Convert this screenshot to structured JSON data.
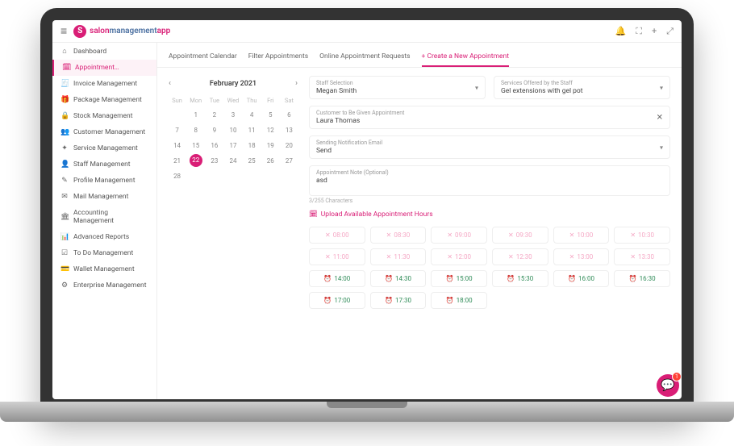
{
  "brand": {
    "logo": "S",
    "text1": "salon",
    "text2": "management",
    "text3": "app"
  },
  "sidebar": [
    {
      "icon": "⌂",
      "label": "Dashboard"
    },
    {
      "icon": "🗓",
      "label": "Appointment…"
    },
    {
      "icon": "🧾",
      "label": "Invoice Management"
    },
    {
      "icon": "🎁",
      "label": "Package Management"
    },
    {
      "icon": "🔒",
      "label": "Stock Management"
    },
    {
      "icon": "👥",
      "label": "Customer Management"
    },
    {
      "icon": "✦",
      "label": "Service Management"
    },
    {
      "icon": "👤",
      "label": "Staff Management"
    },
    {
      "icon": "✎",
      "label": "Profile Management"
    },
    {
      "icon": "✉",
      "label": "Mail Management"
    },
    {
      "icon": "🏛",
      "label": "Accounting Management"
    },
    {
      "icon": "📊",
      "label": "Advanced Reports"
    },
    {
      "icon": "☑",
      "label": "To Do Management"
    },
    {
      "icon": "💳",
      "label": "Wallet Management"
    },
    {
      "icon": "⚙",
      "label": "Enterprise Management"
    }
  ],
  "tabs": [
    "Appointment Calendar",
    "Filter Appointments",
    "Online Appointment Requests",
    "+ Create a New Appointment"
  ],
  "cal": {
    "title": "February 2021",
    "dow": [
      "Sun",
      "Mon",
      "Tue",
      "Wed",
      "Thu",
      "Fri",
      "Sat"
    ],
    "days": [
      {
        "n": "",
        "m": 1
      },
      {
        "n": "1",
        "m": 0
      },
      {
        "n": "2",
        "m": 0
      },
      {
        "n": "3",
        "m": 0
      },
      {
        "n": "4",
        "m": 0
      },
      {
        "n": "5",
        "m": 0
      },
      {
        "n": "6",
        "m": 0
      },
      {
        "n": "7",
        "m": 0
      },
      {
        "n": "8",
        "m": 0
      },
      {
        "n": "9",
        "m": 0
      },
      {
        "n": "10",
        "m": 0
      },
      {
        "n": "11",
        "m": 0
      },
      {
        "n": "12",
        "m": 0
      },
      {
        "n": "13",
        "m": 0
      },
      {
        "n": "14",
        "m": 0
      },
      {
        "n": "15",
        "m": 0
      },
      {
        "n": "16",
        "m": 0
      },
      {
        "n": "17",
        "m": 0
      },
      {
        "n": "18",
        "m": 0
      },
      {
        "n": "19",
        "m": 0
      },
      {
        "n": "20",
        "m": 0
      },
      {
        "n": "21",
        "m": 0
      },
      {
        "n": "22",
        "m": 0,
        "sel": 1
      },
      {
        "n": "23",
        "m": 0
      },
      {
        "n": "24",
        "m": 0
      },
      {
        "n": "25",
        "m": 0
      },
      {
        "n": "26",
        "m": 0
      },
      {
        "n": "27",
        "m": 0
      },
      {
        "n": "28",
        "m": 0
      }
    ]
  },
  "form": {
    "staff": {
      "label": "Staff Selection",
      "value": "Megan Smith"
    },
    "service": {
      "label": "Services Offered by the Staff",
      "value": "Gel extensions with gel pot"
    },
    "customer": {
      "label": "Customer to Be Given Appointment",
      "value": "Laura Thomas"
    },
    "notify": {
      "label": "Sending Notification Email",
      "value": "Send"
    },
    "note": {
      "label": "Appointment Note (Optional)",
      "value": "asd"
    },
    "chars": "3/255 Characters",
    "upload": "Upload Available Appointment Hours"
  },
  "slots": [
    {
      "t": "08:00",
      "a": 0
    },
    {
      "t": "08:30",
      "a": 0
    },
    {
      "t": "09:00",
      "a": 0
    },
    {
      "t": "09:30",
      "a": 0
    },
    {
      "t": "10:00",
      "a": 0
    },
    {
      "t": "10:30",
      "a": 0
    },
    {
      "t": "11:00",
      "a": 0
    },
    {
      "t": "11:30",
      "a": 0
    },
    {
      "t": "12:00",
      "a": 0
    },
    {
      "t": "12:30",
      "a": 0
    },
    {
      "t": "13:00",
      "a": 0
    },
    {
      "t": "13:30",
      "a": 0
    },
    {
      "t": "14:00",
      "a": 1
    },
    {
      "t": "14:30",
      "a": 1
    },
    {
      "t": "15:00",
      "a": 1
    },
    {
      "t": "15:30",
      "a": 1
    },
    {
      "t": "16:00",
      "a": 1
    },
    {
      "t": "16:30",
      "a": 1
    },
    {
      "t": "17:00",
      "a": 1
    },
    {
      "t": "17:30",
      "a": 1
    },
    {
      "t": "18:00",
      "a": 1
    }
  ],
  "chat_badge": "1"
}
